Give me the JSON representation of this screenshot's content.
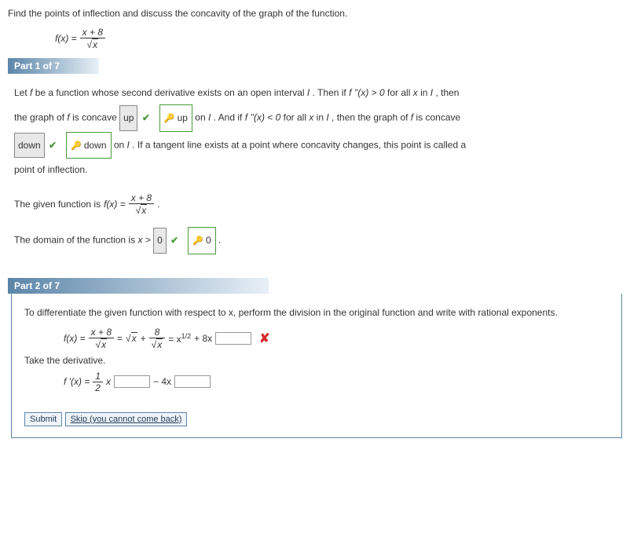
{
  "prompt": {
    "text": "Find the points of inflection and discuss the concavity of the graph of the function.",
    "func_lhs": "f(x) = ",
    "frac_num": "x + 8",
    "frac_den_rad": "x"
  },
  "part1": {
    "header": "Part 1 of 7",
    "t1": "Let ",
    "t2": " be a function whose second derivative exists on an open interval ",
    "t3": ". Then if  ",
    "cond1": "f ''(x) > 0",
    "t4": "  for all ",
    "t5": " in ",
    "t6": ", then",
    "t7": "the graph of ",
    "t8": " is concave ",
    "ans1": "up",
    "key1": "up",
    "t9": " on ",
    "t10": ". And if  ",
    "cond2": "f ''(x) < 0",
    "t11": "  for all ",
    "t12": " in ",
    "t13": ", then the graph of ",
    "t14": " is concave",
    "ans2": "down",
    "key2": "down",
    "t15": " on ",
    "t16": ". If a tangent line exists at a point where concavity changes, this point is called a",
    "t17": "point of inflection.",
    "given_l": "The given function is  ",
    "given_fn": "f(x) = ",
    "given_num": "x + 8",
    "given_den_rad": "x",
    "given_r": ".",
    "domain_l": "The domain of the function is ",
    "domain_var": "x > ",
    "ans3": "0",
    "key3": "0",
    "domain_r": " ."
  },
  "part2": {
    "header": "Part 2 of 7",
    "instr": "To differentiate the given function with respect to x, perform the division in the original function and write with rational exponents.",
    "fx": "f(x) = ",
    "num1": "x + 8",
    "radx": "x",
    "eq": " = ",
    "plus": " + ",
    "eight": "8",
    "eq2": " = x",
    "exp1": "1/2",
    "p8x": " + 8x",
    "take": "Take the derivative.",
    "fpx": "f '(x) = ",
    "half_num": "1",
    "half_den": "2",
    "xletter": "x",
    "minus4x": " − 4x",
    "btn_submit": "Submit",
    "btn_skip": "Skip (you cannot come back)"
  }
}
